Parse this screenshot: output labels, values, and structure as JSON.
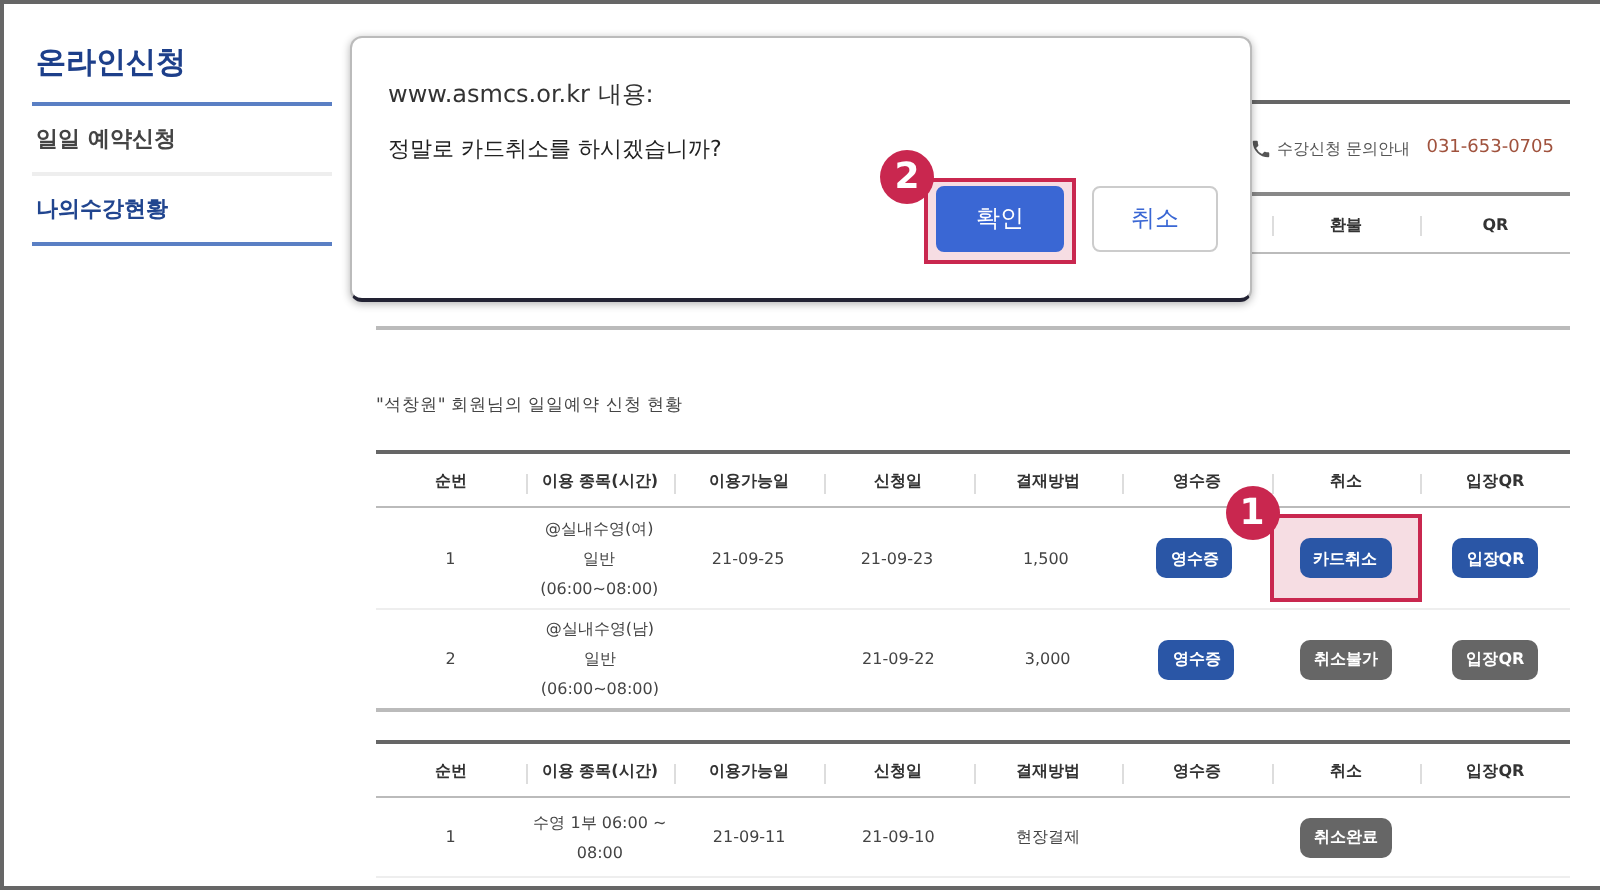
{
  "sidebar": {
    "title": "온라인신청",
    "items": [
      {
        "label": "일일 예약신청",
        "selected": false
      },
      {
        "label": "나의수강현황",
        "selected": true
      }
    ]
  },
  "contact": {
    "label": "수강신청 문의안내",
    "phone": "031-653-0705"
  },
  "history_table": {
    "columns": [
      "환불",
      "QR"
    ]
  },
  "caption": "\"석창원\" 회원님의 일일예약 신청 현황",
  "reservations": {
    "columns": [
      "순번",
      "이용 종목(시간)",
      "이용가능일",
      "신청일",
      "결재방법",
      "영수증",
      "취소",
      "입장QR"
    ],
    "rows": [
      {
        "no": "1",
        "item": [
          "@실내수영(여)",
          "일반",
          "(06:00~08:00)"
        ],
        "available": "21-09-25",
        "applied": "21-09-23",
        "payment": "1,500",
        "receipt": {
          "label": "영수증",
          "disabled": false
        },
        "cancel": {
          "label": "카드취소",
          "disabled": false,
          "highlighted": true,
          "callout": "1"
        },
        "qr": {
          "label": "입장QR",
          "disabled": false
        }
      },
      {
        "no": "2",
        "item": [
          "@실내수영(남)",
          "일반",
          "(06:00~08:00)"
        ],
        "applied": "21-09-22",
        "payment": "3,000",
        "receipt": {
          "label": "영수증",
          "disabled": false
        },
        "cancel": {
          "label": "취소불가",
          "disabled": true
        },
        "qr": {
          "label": "입장QR",
          "disabled": true
        }
      }
    ]
  },
  "cancelled": {
    "columns": [
      "순번",
      "이용 종목(시간)",
      "이용가능일",
      "신청일",
      "결재방법",
      "영수증",
      "취소",
      "입장QR"
    ],
    "rows": [
      {
        "no": "1",
        "item": [
          "수영 1부 06:00 ~",
          "08:00"
        ],
        "available": "21-09-11",
        "applied": "21-09-10",
        "payment": "현장결제",
        "cancel": {
          "label": "취소완료",
          "disabled": true
        }
      }
    ]
  },
  "dialog": {
    "origin": "www.asmcs.or.kr 내용:",
    "message": "정말로 카드취소를 하시겠습니까?",
    "buttons": [
      {
        "label": "확인",
        "kind": "primary",
        "highlighted": true,
        "callout": "2"
      },
      {
        "label": "취소",
        "kind": "secondary"
      }
    ]
  }
}
